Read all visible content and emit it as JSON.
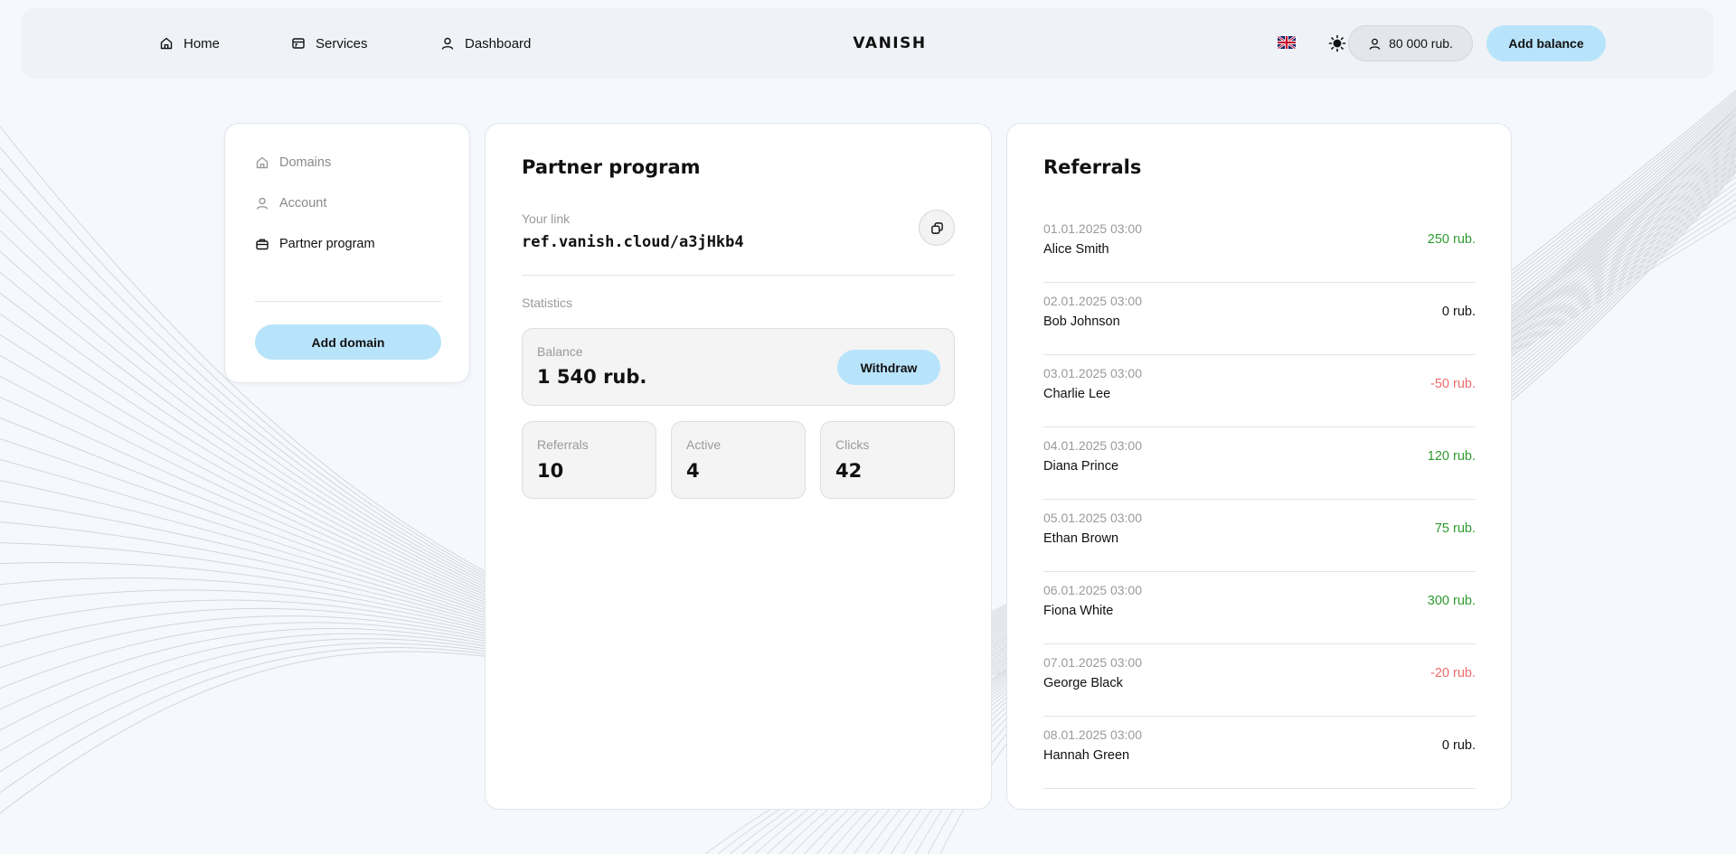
{
  "nav": {
    "items": [
      {
        "label": "Home",
        "icon": "home-icon"
      },
      {
        "label": "Services",
        "icon": "services-icon"
      },
      {
        "label": "Dashboard",
        "icon": "user-icon"
      }
    ],
    "logo": "VANISH",
    "language_flag": "uk-flag-icon",
    "theme_icon": "sun-icon",
    "balance": "80 000 rub.",
    "add_balance_label": "Add balance"
  },
  "sidebar": {
    "items": [
      {
        "label": "Domains",
        "icon": "home-icon",
        "active": false
      },
      {
        "label": "Account",
        "icon": "user-icon",
        "active": false
      },
      {
        "label": "Partner program",
        "icon": "briefcase-icon",
        "active": true
      }
    ],
    "add_domain_label": "Add domain"
  },
  "partner": {
    "title": "Partner program",
    "link_label": "Your link",
    "link_value": "ref.vanish.cloud/a3jHkb4",
    "copy_icon": "copy-icon",
    "statistics_label": "Statistics",
    "balance_label": "Balance",
    "balance_value": "1 540 rub.",
    "withdraw_label": "Withdraw",
    "stats": [
      {
        "label": "Referrals",
        "value": "10"
      },
      {
        "label": "Active",
        "value": "4"
      },
      {
        "label": "Clicks",
        "value": "42"
      }
    ]
  },
  "referrals": {
    "title": "Referrals",
    "items": [
      {
        "date": "01.01.2025 03:00",
        "name": "Alice Smith",
        "amount": "250 rub.",
        "status": "positive"
      },
      {
        "date": "02.01.2025 03:00",
        "name": "Bob Johnson",
        "amount": "0 rub.",
        "status": "neutral"
      },
      {
        "date": "03.01.2025 03:00",
        "name": "Charlie Lee",
        "amount": "-50 rub.",
        "status": "negative"
      },
      {
        "date": "04.01.2025 03:00",
        "name": "Diana Prince",
        "amount": "120 rub.",
        "status": "positive"
      },
      {
        "date": "05.01.2025 03:00",
        "name": "Ethan Brown",
        "amount": "75 rub.",
        "status": "positive"
      },
      {
        "date": "06.01.2025 03:00",
        "name": "Fiona White",
        "amount": "300 rub.",
        "status": "positive"
      },
      {
        "date": "07.01.2025 03:00",
        "name": "George Black",
        "amount": "-20 rub.",
        "status": "negative"
      },
      {
        "date": "08.01.2025 03:00",
        "name": "Hannah Green",
        "amount": "0 rub.",
        "status": "neutral"
      }
    ]
  },
  "colors": {
    "accent": "#b8e4fb",
    "positive": "#2e9a2e",
    "negative": "#ef6b6b",
    "neutral": "#111111"
  }
}
